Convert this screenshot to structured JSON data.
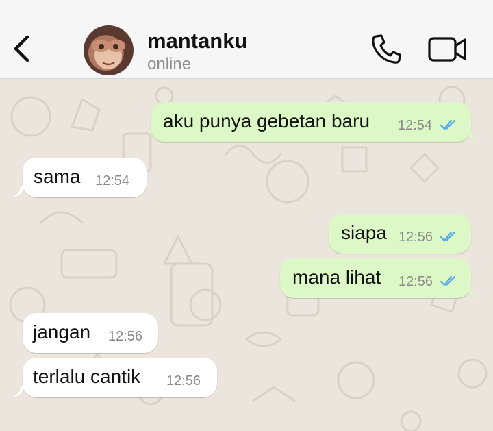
{
  "header": {
    "contact_name": "mantanku",
    "status": "online",
    "icons": {
      "back": "chevron-left-icon",
      "call": "phone-icon",
      "video": "video-camera-icon"
    }
  },
  "colors": {
    "outgoing_bubble": "#dcf8c6",
    "incoming_bubble": "#ffffff",
    "read_ticks": "#4fa8e8",
    "wallpaper": "#ece5dd"
  },
  "messages": [
    {
      "direction": "outgoing",
      "text": "aku punya gebetan baru",
      "time": "12:54",
      "status": "read"
    },
    {
      "direction": "incoming",
      "text": "sama",
      "time": "12:54"
    },
    {
      "direction": "outgoing",
      "text": "siapa",
      "time": "12:56",
      "status": "read"
    },
    {
      "direction": "outgoing",
      "text": "mana lihat",
      "time": "12:56",
      "status": "read"
    },
    {
      "direction": "incoming",
      "text": "jangan",
      "time": "12:56"
    },
    {
      "direction": "incoming",
      "text": "terlalu cantik",
      "time": "12:56"
    }
  ]
}
